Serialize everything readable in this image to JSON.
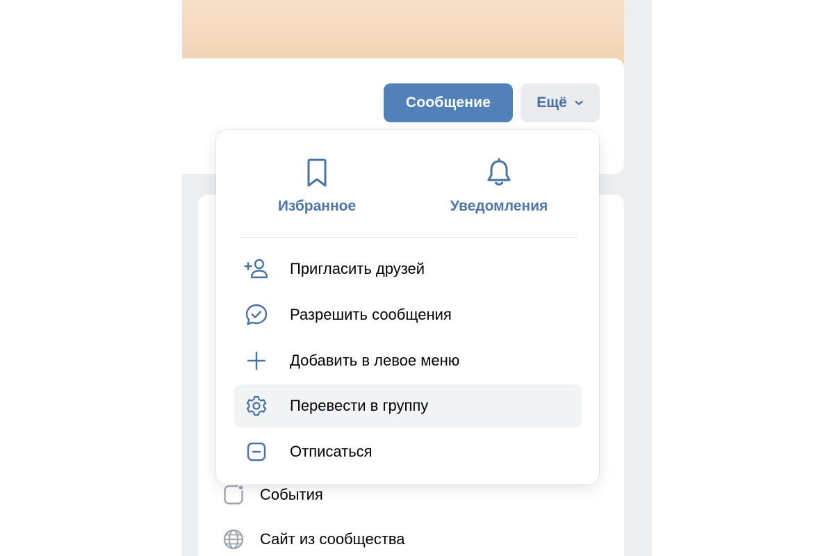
{
  "header": {
    "message_button": "Сообщение",
    "more_button": "Ещё"
  },
  "dropdown": {
    "quick_actions": [
      {
        "label": "Избранное",
        "icon": "bookmark-icon"
      },
      {
        "label": "Уведомления",
        "icon": "bell-icon"
      }
    ],
    "items": [
      {
        "label": "Пригласить друзей",
        "icon": "add-user-icon"
      },
      {
        "label": "Разрешить сообщения",
        "icon": "message-check-icon"
      },
      {
        "label": "Добавить в левое меню",
        "icon": "plus-icon"
      },
      {
        "label": "Перевести в группу",
        "icon": "gear-icon",
        "highlighted": true
      },
      {
        "label": "Отписаться",
        "icon": "minus-square-icon"
      }
    ]
  },
  "background_menu": {
    "items": [
      {
        "label": "События",
        "icon": "events-icon"
      },
      {
        "label": "Сайт из сообщества",
        "icon": "globe-icon"
      }
    ]
  },
  "colors": {
    "accent": "#5181b8",
    "link": "#4d76a8",
    "icon": "#4a72a4",
    "cover": "#f2d5b8",
    "hover": "#f2f3f5"
  }
}
